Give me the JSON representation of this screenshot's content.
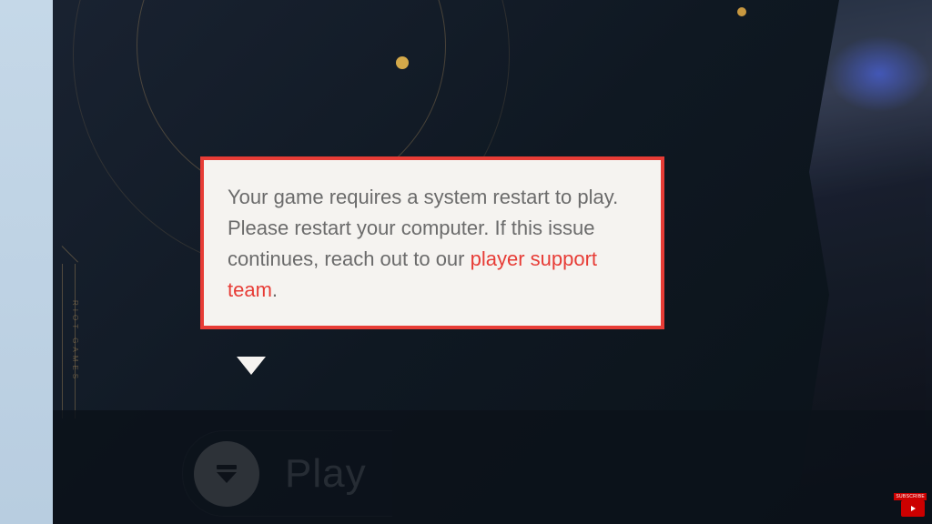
{
  "tooltip": {
    "message_part1": "Your game requires a system restart to play. Please restart your computer. If this issue continues, reach out to our ",
    "link_text": "player support team",
    "message_part2": "."
  },
  "play_button": {
    "label": "Play"
  },
  "side_label": "RIOT GAMES",
  "yt": {
    "subscribe": "SUBSCRIBE"
  },
  "colors": {
    "accent_red": "#e73c36",
    "gold": "#d4a94a"
  }
}
